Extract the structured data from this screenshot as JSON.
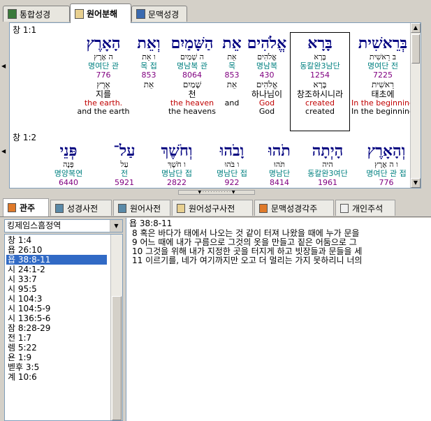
{
  "top_tabs": [
    {
      "label": "통합성경",
      "icon": "bible-book-icon"
    },
    {
      "label": "원어분해",
      "icon": "scroll-icon"
    },
    {
      "label": "문맥성경",
      "icon": "book-icon"
    }
  ],
  "verse1": {
    "ref": "창 1:1",
    "words": [
      {
        "heb": "בְּרֵאשִׁית",
        "root": "בּ  רֵאשִׁית",
        "gram": "명여단  전",
        "strong": "7225",
        "lemma": "רֵאשִׁית",
        "kor": "태초에",
        "eng": "In the beginning",
        "eng2": "In the beginning"
      },
      {
        "heb": "בָּרָא",
        "root": "בָּרָא",
        "gram": "동칼완3남단",
        "strong": "1254",
        "lemma": "בָּרָא",
        "kor": "창조하시니라",
        "eng": "created",
        "eng2": "created"
      },
      {
        "heb": "אֱלֹהִים",
        "root": "אֱלֹהִים",
        "gram": "명남복",
        "strong": "430",
        "lemma": "אֱלֹהִים",
        "kor": "하나님이",
        "eng": "God",
        "eng2": "God"
      },
      {
        "heb": "אֵת",
        "root": "אֵת",
        "gram": "목",
        "strong": "853",
        "lemma": "אֵת",
        "kor": "",
        "eng": "and",
        "eng2": ""
      },
      {
        "heb": "הַשָּׁמַיִם",
        "root": "ה  שָׁמַיִם",
        "gram": "명남복  관",
        "strong": "8064",
        "lemma": "שָׁמַיִם",
        "kor": "천",
        "eng": "the heaven",
        "eng2": "the heavens"
      },
      {
        "heb": "וְאֵת",
        "root": "ו  אֵת",
        "gram": "목  접",
        "strong": "853",
        "lemma": "אֵת",
        "kor": "",
        "eng": "",
        "eng2": ""
      },
      {
        "heb": "הָאָרֶץ",
        "root": "ה  אֶרֶץ",
        "gram": "명여단  관",
        "strong": "776",
        "lemma": "אֶרֶץ",
        "kor": "지를",
        "eng": "the earth.",
        "eng2": "and the earth"
      }
    ]
  },
  "verse2": {
    "ref": "창 1:2",
    "words": [
      {
        "heb": "וְהָאָרֶץ",
        "root": "ו  ה  אֶרֶץ",
        "gram": "명여단  관  접",
        "strong": "776"
      },
      {
        "heb": "הָיְתָה",
        "root": "היה",
        "gram": "동칼완3여단",
        "strong": "1961"
      },
      {
        "heb": "תֹהוּ",
        "root": "תֹּהוּ",
        "gram": "명남단",
        "strong": "8414"
      },
      {
        "heb": "וָבֹהוּ",
        "root": "ו  בֹּהוּ",
        "gram": "명남단  접",
        "strong": "922"
      },
      {
        "heb": "וְחֹשֶׁךְ",
        "root": "ו  חֹשֶׁךְ",
        "gram": "명남단  접",
        "strong": "2822"
      },
      {
        "heb": "עַל־",
        "root": "עַל",
        "gram": "전",
        "strong": "5921"
      },
      {
        "heb": "פְּנֵי",
        "root": "פָּנֶה",
        "gram": "명양복연",
        "strong": "6440"
      }
    ]
  },
  "bottom_tabs": [
    {
      "label": "관주",
      "icon": "open-book-icon"
    },
    {
      "label": "성경사전",
      "icon": "dictionary-icon"
    },
    {
      "label": "원어사전",
      "icon": "dictionary-icon"
    },
    {
      "label": "원어성구사전",
      "icon": "scroll-icon"
    },
    {
      "label": "문맥성경각주",
      "icon": "open-book-icon"
    },
    {
      "label": "개인주석",
      "icon": "pen-icon"
    }
  ],
  "version_select": {
    "value": "킹제임스흠정역"
  },
  "references": [
    "창 1:4",
    "욥 26:10",
    "욥 38:8-11",
    "시 24:1-2",
    "시 33:7",
    "시 95:5",
    "시 104:3",
    "시 104:5-9",
    "시 136:5-6",
    "잠 8:28-29",
    "전 1:7",
    "렘 5:22",
    "욘 1:9",
    "벧후 3:5",
    "계 10:6"
  ],
  "selected_reference": "욥 38:8-11",
  "passage": {
    "ref": "욥 38:8-11",
    "lines": [
      "8 혹은 바다가 태에서 나오는 것 같이 터져 나왔을 때에 누가 문을",
      "9 어느 때에 내가 구름으로 그것의 옷을 만들고 짙은 어둠으로 그",
      "10 그것을 위해 내가 지정한 곳을 터지게 하고 빗장들과 문들을 세",
      "11 이르기를, 네가 여기까지만 오고 더 멀리는 가지 못하리니 너의"
    ]
  },
  "colors": {
    "hebrew": "#000080",
    "grammar": "#008080",
    "strong": "#800080",
    "english": "#c00000",
    "selection": "#316ac5"
  }
}
